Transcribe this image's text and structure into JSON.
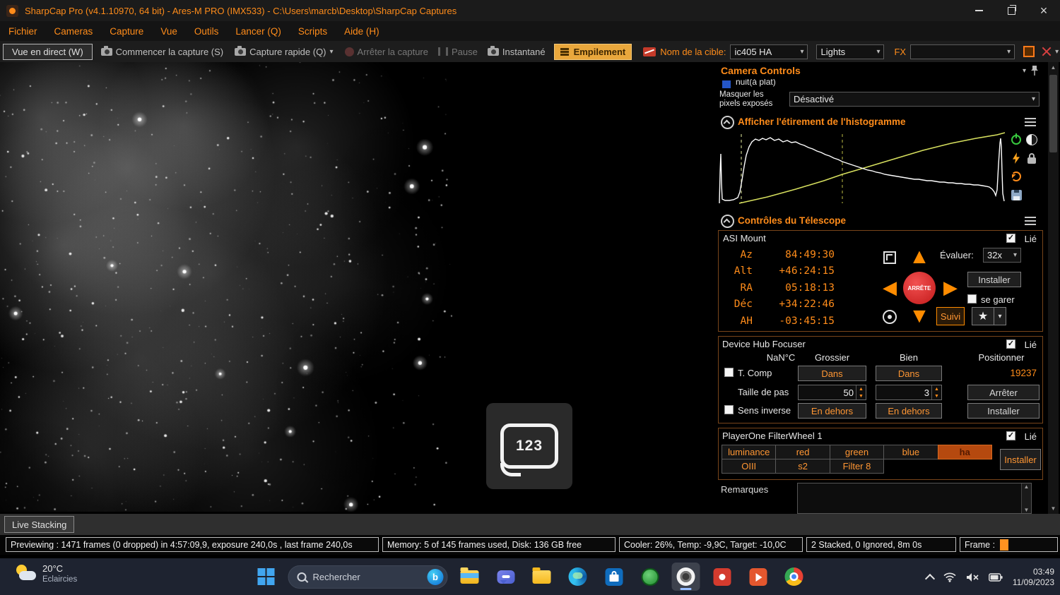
{
  "window": {
    "title": "SharpCap Pro (v4.1.10970, 64 bit) - Ares-M PRO (IMX533) - C:\\Users\\marcb\\Desktop\\SharpCap Captures"
  },
  "menu": {
    "items": [
      "Fichier",
      "Cameras",
      "Capture",
      "Vue",
      "Outils",
      "Lancer (Q)",
      "Scripts",
      "Aide (H)"
    ]
  },
  "toolbar": {
    "live_view": "Vue en direct (W)",
    "start_capture": "Commencer la capture (S)",
    "quick_capture": "Capture rapide (Q)",
    "stop_capture": "Arrêter la capture",
    "pause": "Pause",
    "snapshot": "Instantané",
    "stacking": "Empilement",
    "target_label": "Nom de la cible:",
    "target_value": "ic405 HA",
    "frame_type_value": "Lights",
    "fx_label": "FX"
  },
  "panel": {
    "title": "Camera Controls",
    "partial_item": "nuit(à plat)",
    "mask_label_line1": "Masquer les",
    "mask_label_line2": "pixels exposés",
    "mask_value": "Désactivé",
    "histogram": {
      "title": "Afficher l'étirement de l'histogramme"
    },
    "telescope": {
      "title": "Contrôles du Télescope",
      "device": "ASI Mount",
      "linked": "Lié",
      "coords": [
        {
          "label": "Az",
          "value": "84:49:30"
        },
        {
          "label": "Alt",
          "value": "+46:24:15"
        },
        {
          "label": "RA",
          "value": "05:18:13"
        },
        {
          "label": "Déc",
          "value": "+34:22:46"
        },
        {
          "label": "AH",
          "value": "-03:45:15"
        }
      ],
      "stop": "ARRÊTE",
      "rate_label": "Évaluer:",
      "rate_value": "32x",
      "install": "Installer",
      "park": "se garer",
      "tracking": "Suivi"
    },
    "focuser": {
      "title": "Device Hub Focuser",
      "linked": "Lié",
      "temp_header": "NaN°C",
      "coarse_header": "Grossier",
      "fine_header": "Bien",
      "position_header": "Positionner",
      "tcomp": "T. Comp",
      "in_coarse": "Dans",
      "in_fine": "Dans",
      "position": "19237",
      "step_label": "Taille de pas",
      "step_coarse": "50",
      "step_fine": "3",
      "stop": "Arrêter",
      "reverse": "Sens inverse",
      "out_coarse": "En dehors",
      "out_fine": "En dehors",
      "install": "Installer"
    },
    "filterwheel": {
      "title": "PlayerOne FilterWheel 1",
      "linked": "Lié",
      "filters": [
        "luminance",
        "red",
        "green",
        "blue",
        "ha",
        "OIII",
        "s2",
        "Filter 8"
      ],
      "active_filter": "ha",
      "install": "Installer"
    },
    "notes_label": "Remarques"
  },
  "osd": {
    "label": "123"
  },
  "tabs": {
    "live_stacking": "Live Stacking"
  },
  "status": {
    "previewing": "Previewing : 1471 frames (0 dropped) in 4:57:09,9, exposure 240,0s , last frame 240,0s",
    "memory": "Memory: 5 of 145 frames used, Disk: 136 GB free",
    "cooler": "Cooler: 26%, Temp: -9,9C, Target: -10,0C",
    "stacked": "2 Stacked, 0 Ignored, 8m 0s",
    "frame_label": "Frame :"
  },
  "taskbar": {
    "weather_temp": "20°C",
    "weather_desc": "Eclaircies",
    "search": "Rechercher",
    "time": "03:49",
    "date": "11/09/2023"
  },
  "colors": {
    "accent_orange": "#ff8c1a",
    "stack_highlight": "#e9a73c",
    "stop_red": "#d62c2c",
    "histogram_curve": "#ffffff",
    "histogram_stretch_line": "#d6df5e"
  }
}
